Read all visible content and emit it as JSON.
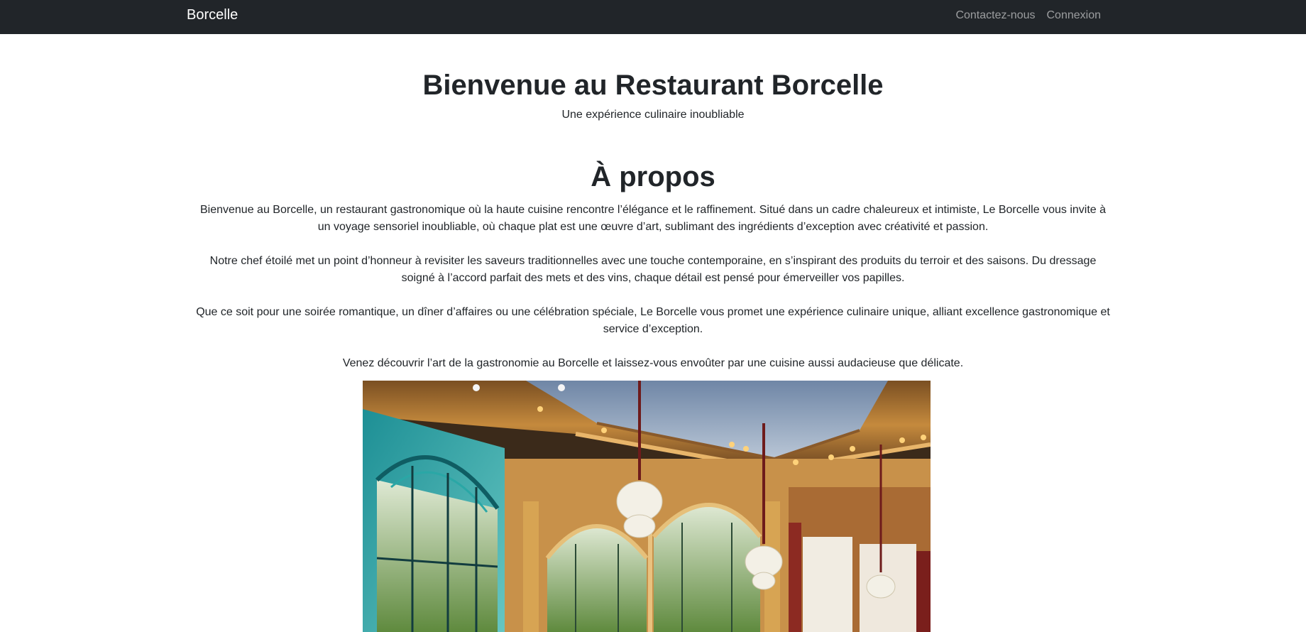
{
  "navbar": {
    "brand": "Borcelle",
    "links": [
      "Contactez-nous",
      "Connexion"
    ]
  },
  "hero": {
    "title": "Bienvenue au Restaurant Borcelle",
    "subtitle": "Une expérience culinaire inoubliable"
  },
  "about": {
    "heading": "À propos",
    "paragraphs": [
      "Bienvenue au Borcelle, un restaurant gastronomique où la haute cuisine rencontre l’élégance et le raffinement. Situé dans un cadre chaleureux et intimiste, Le Borcelle vous invite à un voyage sensoriel inoubliable, où chaque plat est une œuvre d’art, sublimant des ingrédients d’exception avec créativité et passion.",
      "Notre chef étoilé met un point d’honneur à revisiter les saveurs traditionnelles avec une touche contemporaine, en s’inspirant des produits du terroir et des saisons. Du dressage soigné à l’accord parfait des mets et des vins, chaque détail est pensé pour émerveiller vos papilles.",
      "Que ce soit pour une soirée romantique, un dîner d’affaires ou une célébration spéciale, Le Borcelle vous promet une expérience culinaire unique, alliant excellence gastronomique et service d’exception.",
      "Venez découvrir l’art de la gastronomie au Borcelle et laissez-vous envoûter par une cuisine aussi audacieuse que délicate."
    ]
  },
  "colors": {
    "navbar_bg": "#212529",
    "brand_text": "#ffffff",
    "nav_link_text": "#a6a8aa",
    "body_text": "#212529"
  },
  "icons": []
}
